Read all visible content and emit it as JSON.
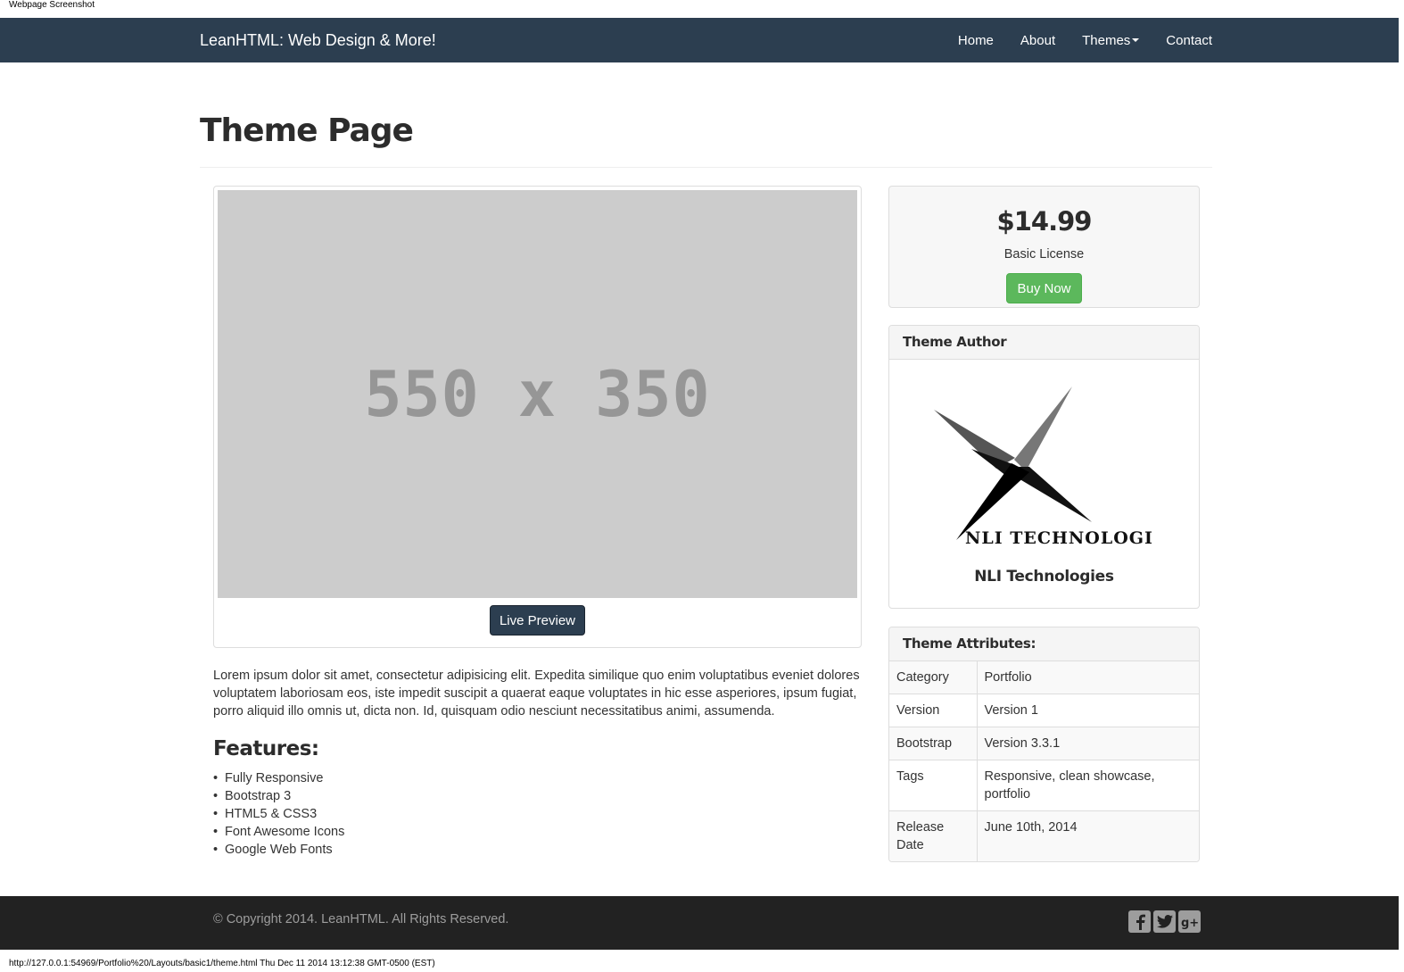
{
  "caption": "Webpage Screenshot",
  "navbar": {
    "brand": "LeanHTML: Web Design & More!",
    "links": [
      "Home",
      "About",
      "Themes",
      "Contact"
    ]
  },
  "page": {
    "title": "Theme Page",
    "placeholder_text": "550 x 350",
    "live_preview_label": "Live Preview",
    "description": "Lorem ipsum dolor sit amet, consectetur adipisicing elit. Expedita similique quo enim voluptatibus eveniet dolores voluptatem laboriosam eos, iste impedit suscipit a quaerat eaque voluptates in hic esse asperiores, ipsum fugiat, porro aliquid illo omnis ut, dicta non. Id, quisquam odio nesciunt necessitatibus animi, assumenda.",
    "features_heading": "Features:",
    "features": [
      "Fully Responsive",
      "Bootstrap 3",
      "HTML5 & CSS3",
      "Font Awesome Icons",
      "Google Web Fonts"
    ]
  },
  "pricing": {
    "price": "$14.99",
    "license": "Basic License",
    "buy_label": "Buy Now"
  },
  "author": {
    "heading": "Theme Author",
    "logo_text": "NLI TECHNOLOGI",
    "name": "NLI Technologies"
  },
  "attributes": {
    "heading": "Theme Attributes:",
    "rows": [
      {
        "key": "Category",
        "value": "Portfolio"
      },
      {
        "key": "Version",
        "value": "Version 1"
      },
      {
        "key": "Bootstrap",
        "value": "Version 3.3.1"
      },
      {
        "key": "Tags",
        "value": "Responsive, clean showcase, portfolio"
      },
      {
        "key": "Release Date",
        "value": "June 10th, 2014"
      }
    ]
  },
  "footer": {
    "copyright": "© Copyright 2014. LeanHTML. All Rights Reserved.",
    "social_icons": [
      "facebook-icon",
      "twitter-icon",
      "google-plus-icon"
    ]
  },
  "status_bar": "http://127.0.0.1:54969/Portfolio%20/Layouts/basic1/theme.html Thu Dec 11 2014 13:12:38 GMT-0500 (EST)",
  "colors": {
    "navbar": "#2c3e50",
    "buy_button": "#5cb85c",
    "footer": "#222222",
    "placeholder": "#cccccc"
  }
}
